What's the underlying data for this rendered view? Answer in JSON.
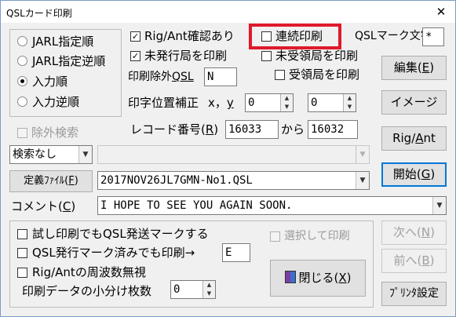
{
  "window": {
    "title": "QSLカード印刷",
    "close": "✕"
  },
  "sort_options": [
    {
      "label": "JARL指定順",
      "selected": false
    },
    {
      "label": "JARL指定逆順",
      "selected": false
    },
    {
      "label": "入力順",
      "selected": true
    },
    {
      "label": "入力逆順",
      "selected": false
    }
  ],
  "checks": {
    "rig_ant_confirm": {
      "label": "Rig/Ant確認あり",
      "checked": true
    },
    "print_unissued": {
      "label": "未発行局を印刷",
      "checked": true
    },
    "continuous_print": {
      "label": "連続印刷",
      "checked": false
    },
    "print_unreceived": {
      "label": "未受領局を印刷",
      "checked": false
    },
    "print_received": {
      "label": "受領局を印刷",
      "checked": false
    },
    "exclude_search": {
      "label": "除外検索",
      "checked": false
    },
    "test_print_mark": {
      "label": "試し印刷でもQSL発送マークする",
      "checked": false
    },
    "print_even_if_marked": {
      "label": "QSL発行マーク済みでも印刷→",
      "checked": false
    },
    "ignore_rig_ant_freq": {
      "label": "Rig/Antの周波数無視",
      "checked": false
    },
    "select_print": {
      "label": "選択して印刷",
      "checked": false
    }
  },
  "qsl_mark": {
    "label": "QSLマーク文字",
    "value": "*"
  },
  "exclude_qsl": {
    "label_prefix": "印刷除外",
    "label_underlined": "QSL",
    "value": "N"
  },
  "print_offset": {
    "label": "印字位置補正",
    "axis_label": "x，",
    "axis_y": "y",
    "x_value": "0",
    "y_value": "0"
  },
  "record_no": {
    "label": "レコード番号(",
    "hotkey": "R",
    "label_suffix": ")",
    "from_value": "16033",
    "middle": "から",
    "to_value": "16032"
  },
  "search": {
    "selected": "検索なし",
    "query": ""
  },
  "definition": {
    "button_prefix": "定義ﾌｧｲﾙ(",
    "hotkey": "F",
    "button_suffix": ")",
    "file": "2017NOV26JL7GMN-No1.QSL"
  },
  "comment": {
    "label_prefix": "コメント(",
    "hotkey": "C",
    "label_suffix": ")",
    "value": "I HOPE TO SEE YOU AGAIN SOON."
  },
  "print_mark_value": "E",
  "split_count": {
    "label": "印刷データの小分け枚数",
    "value": "0"
  },
  "buttons": {
    "edit": {
      "prefix": "編集(",
      "hotkey": "E",
      "suffix": ")"
    },
    "image": {
      "label": "イメージ"
    },
    "rig_ant": {
      "prefix": "Rig/",
      "hotkey": "A",
      "suffix": "nt"
    },
    "start": {
      "prefix": "開始(",
      "hotkey": "G",
      "suffix": ")"
    },
    "next": {
      "prefix": "次へ(",
      "hotkey": "N",
      "suffix": ")"
    },
    "prev": {
      "prefix": "前へ(",
      "hotkey": "B",
      "suffix": ")"
    },
    "close": {
      "prefix": "閉じる(",
      "hotkey": "X",
      "suffix": ")"
    },
    "printer_setup": {
      "label": "ﾌﾟﾘﾝﾀ設定"
    }
  },
  "colors": {
    "highlight": "#e0192b",
    "default_button_border": "#0078d7",
    "window_bg": "#f0f0f0"
  }
}
